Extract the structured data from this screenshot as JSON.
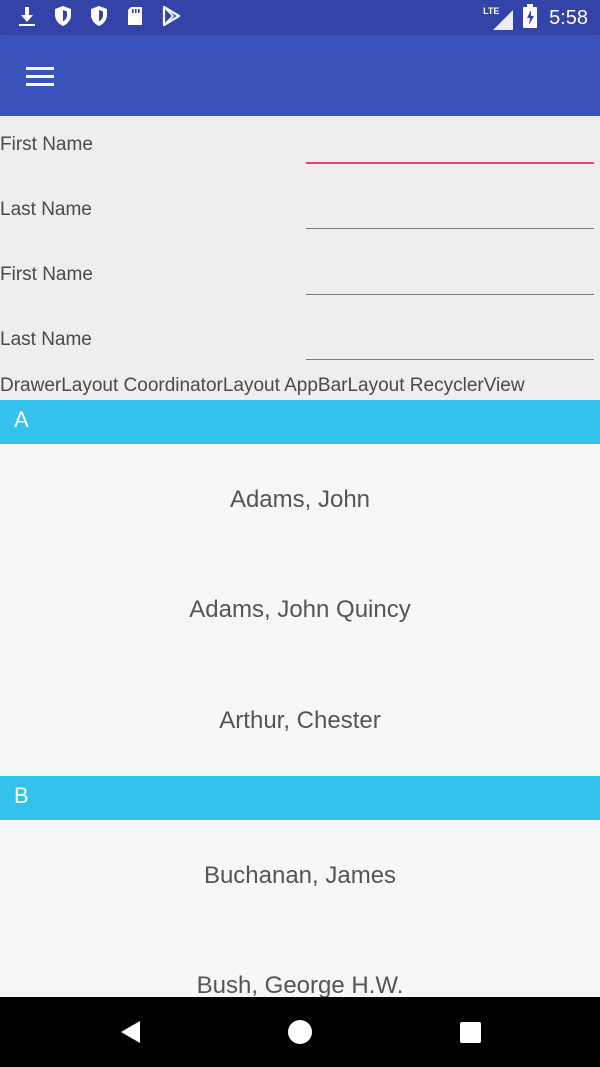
{
  "status_bar": {
    "network_label": "LTE",
    "time": "5:58",
    "left_icons": [
      "download-icon",
      "shield-icon",
      "shield-icon",
      "sd-card-icon",
      "play-store-icon"
    ]
  },
  "app_bar": {
    "menu_icon": "hamburger-menu-icon",
    "color": "#3b53bd"
  },
  "form": {
    "fields": [
      {
        "label": "First Name",
        "value": "",
        "focused": true
      },
      {
        "label": "Last Name",
        "value": "",
        "focused": false
      },
      {
        "label": "First Name",
        "value": "",
        "focused": false
      },
      {
        "label": "Last Name",
        "value": "",
        "focused": false
      }
    ],
    "caption": "DrawerLayout CoordinatorLayout AppBarLayout RecyclerView"
  },
  "list": {
    "header_color": "#33c1ee",
    "sections": [
      {
        "header": "A",
        "items": [
          "Adams, John",
          "Adams, John Quincy",
          "Arthur, Chester"
        ]
      },
      {
        "header": "B",
        "items": [
          "Buchanan, James",
          "Bush, George H.W."
        ]
      }
    ]
  },
  "nav_bar": {
    "buttons": [
      "back-icon",
      "home-icon",
      "recents-icon"
    ]
  }
}
